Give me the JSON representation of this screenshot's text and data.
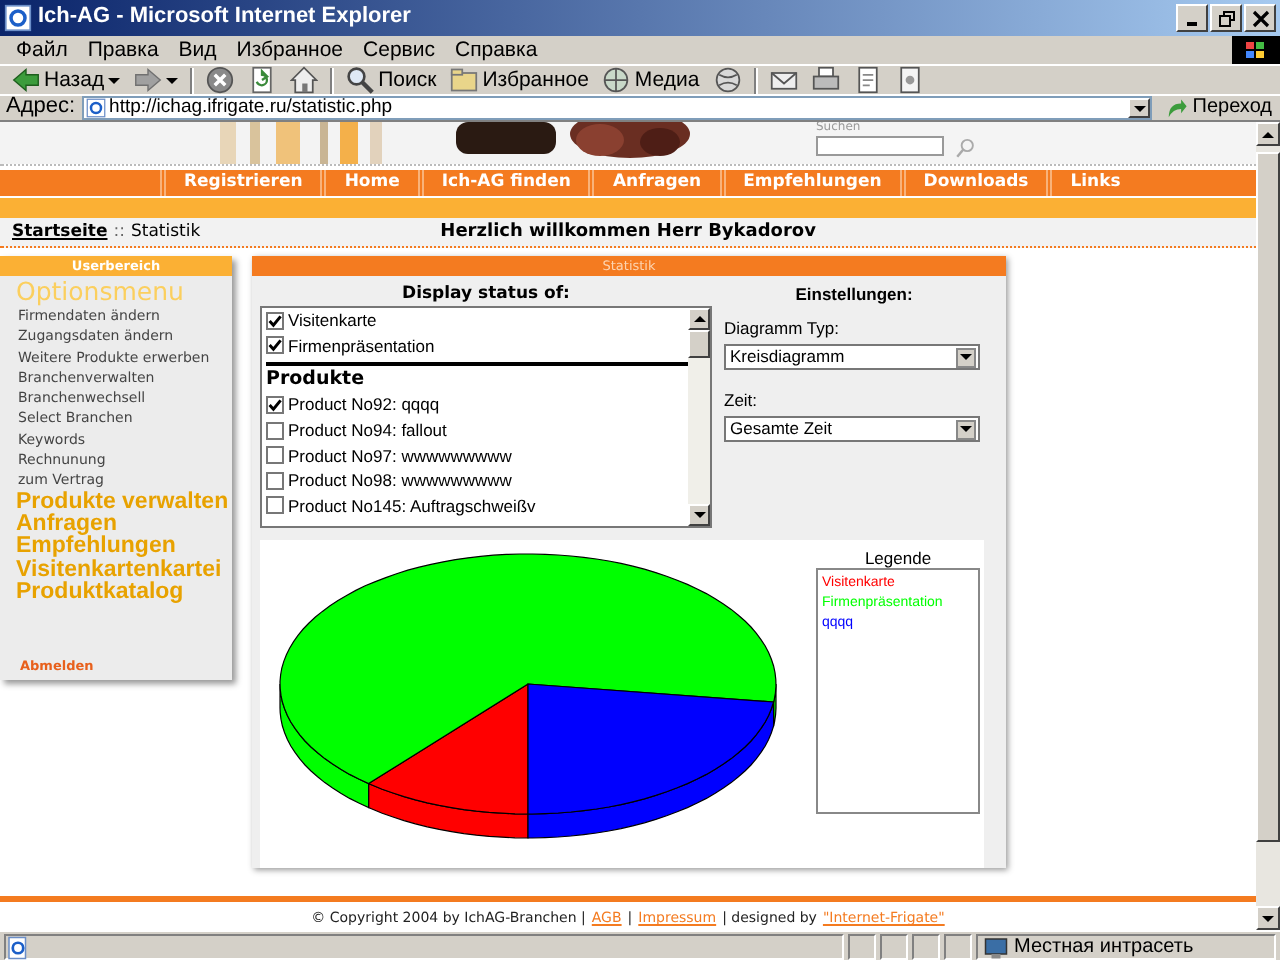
{
  "window": {
    "title": "Ich-AG - Microsoft Internet Explorer"
  },
  "menu": [
    "Файл",
    "Правка",
    "Вид",
    "Избранное",
    "Сервис",
    "Справка"
  ],
  "toolbar": [
    {
      "kind": "back",
      "label": "Назад"
    },
    {
      "kind": "forward"
    },
    {
      "kind": "stop"
    },
    {
      "kind": "refresh"
    },
    {
      "kind": "home"
    },
    {
      "kind": "search",
      "label": "Поиск"
    },
    {
      "kind": "favorites",
      "label": "Избранное"
    },
    {
      "kind": "media",
      "label": "Медиа"
    },
    {
      "kind": "history"
    },
    {
      "kind": "mail"
    },
    {
      "kind": "print"
    },
    {
      "kind": "edit"
    },
    {
      "kind": "discuss"
    }
  ],
  "address": {
    "label": "Адрес:",
    "url": "http://ichag.ifrigate.ru/statistic.php",
    "go": "Переход"
  },
  "page": {
    "search_label": "Suchen",
    "nav": [
      "Registrieren",
      "Home",
      "Ich-AG finden",
      "Anfragen",
      "Empfehlungen",
      "Downloads",
      "Links"
    ],
    "breadcrumb": {
      "link": "Startseite",
      "separator": "::",
      "current": "Statistik"
    },
    "welcome": "Herzlich willkommen Herr Bykadorov",
    "sidebar": {
      "title": "Userbereich",
      "heading": "Optionsmenu",
      "items": [
        "Firmendaten ändern",
        "Zugangsdaten ändern",
        "Weitere Produkte erwerben",
        "Branchenverwalten",
        "Branchenwechsell",
        "Select Branchen",
        "Keywords",
        "Rechnunung",
        "zum Vertrag"
      ],
      "sections": [
        "Produkte verwalten",
        "Anfragen",
        "Empfehlungen",
        "Visitenkartenkartei",
        "Produktkatalog"
      ],
      "logout": "Abmelden"
    },
    "statistik": {
      "title": "Statistik",
      "display_title": "Display status of:",
      "items": [
        {
          "label": "Visitenkarte",
          "checked": true
        },
        {
          "label": "Firmenpräsentation",
          "checked": true
        }
      ],
      "products_title": "Produkte",
      "products": [
        {
          "label": "Product No92: qqqq",
          "checked": true
        },
        {
          "label": "Product No94: fallout",
          "checked": false
        },
        {
          "label": "Product No97: wwwwwwwww",
          "checked": false
        },
        {
          "label": "Product No98: wwwwwwwww",
          "checked": false
        },
        {
          "label": "Product No145: Auftragschweißv",
          "checked": false
        }
      ],
      "settings_title": "Einstellungen:",
      "diagram_label": "Diagramm Typ:",
      "diagram_value": "Kreisdiagramm",
      "time_label": "Zeit:",
      "time_value": "Gesamte Zeit",
      "legend_title": "Legende",
      "legend": [
        {
          "label": "Visitenkarte",
          "color": "#ff0000"
        },
        {
          "label": "Firmenpräsentation",
          "color": "#00ff00"
        },
        {
          "label": "qqqq",
          "color": "#0000ff"
        }
      ]
    },
    "footer": [
      {
        "kind": "text",
        "text": "© Copyright 2004 by IchAG-Branchen |"
      },
      {
        "kind": "link",
        "text": "AGB"
      },
      {
        "kind": "text",
        "text": "|"
      },
      {
        "kind": "link",
        "text": "Impressum"
      },
      {
        "kind": "text",
        "text": "| designed by"
      },
      {
        "kind": "link",
        "text": "\"Internet-Frigate\""
      }
    ]
  },
  "status_bar": {
    "zone": "Местная интрасеть"
  }
}
